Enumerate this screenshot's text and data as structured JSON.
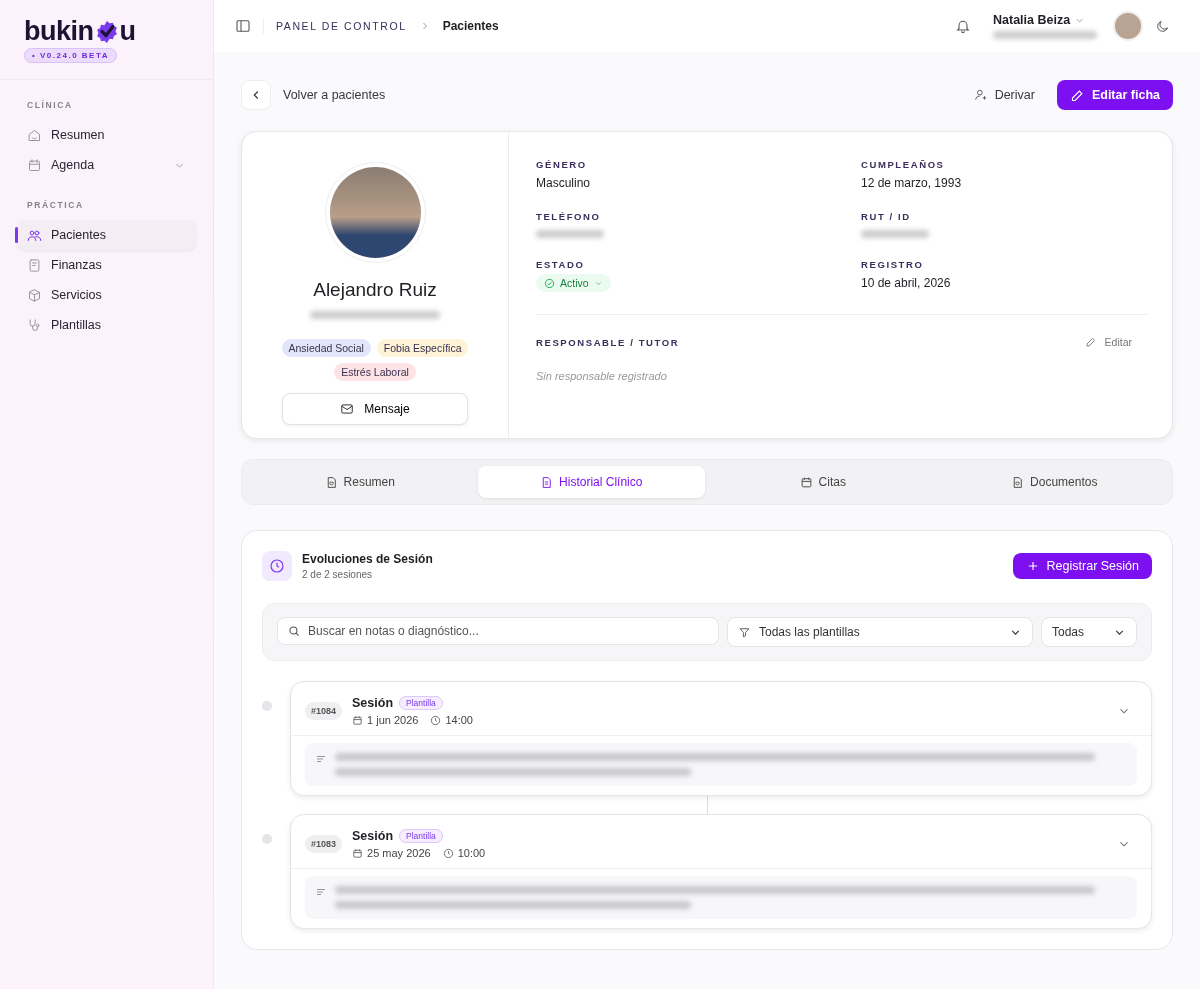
{
  "brand": {
    "text_start": "bukin",
    "text_end": "u",
    "version": "• V0.24.0 BETA"
  },
  "sidebar": {
    "sections": [
      {
        "title": "CLÍNICA",
        "items": [
          {
            "label": "Resumen",
            "selected": false,
            "has_submenu": false
          },
          {
            "label": "Agenda",
            "selected": false,
            "has_submenu": true
          }
        ]
      },
      {
        "title": "PRÁCTICA",
        "items": [
          {
            "label": "Pacientes",
            "selected": true,
            "has_submenu": false
          },
          {
            "label": "Finanzas",
            "selected": false,
            "has_submenu": false
          },
          {
            "label": "Servicios",
            "selected": false,
            "has_submenu": false
          },
          {
            "label": "Plantillas",
            "selected": false,
            "has_submenu": false
          }
        ]
      }
    ]
  },
  "topbar": {
    "breadcrumb": [
      "PANEL DE CONTROL",
      "Pacientes"
    ],
    "user_name": "Natalia Beiza"
  },
  "actions": {
    "back": "Volver a pacientes",
    "refer": "Derivar",
    "edit": "Editar ficha"
  },
  "patient": {
    "name": "Alejandro Ruiz",
    "tags": [
      {
        "label": "Ansiedad Social",
        "color": "#e3e6fb"
      },
      {
        "label": "Fobia Específica",
        "color": "#fdf3d6"
      },
      {
        "label": "Estrés Laboral",
        "color": "#fde2e6"
      }
    ],
    "message_button": "Mensaje",
    "fields": [
      {
        "label": "GÉNERO",
        "value": "Masculino",
        "kind": "text"
      },
      {
        "label": "CUMPLEAÑOS",
        "value": "12 de marzo, 1993",
        "kind": "text"
      },
      {
        "label": "TELÉFONO",
        "kind": "hidden"
      },
      {
        "label": "RUT / ID",
        "kind": "hidden"
      },
      {
        "label": "ESTADO",
        "value": "Activo",
        "kind": "status"
      },
      {
        "label": "REGISTRO",
        "value": "10 de abril, 2026",
        "kind": "text"
      }
    ],
    "guardian": {
      "label": "RESPONSABLE / TUTOR",
      "edit": "Editar",
      "empty": "Sin responsable registrado"
    }
  },
  "tabs": [
    {
      "label": "Resumen",
      "selected": false
    },
    {
      "label": "Historial Clínico",
      "selected": true
    },
    {
      "label": "Citas",
      "selected": false
    },
    {
      "label": "Documentos",
      "selected": false
    }
  ],
  "sessions_panel": {
    "title": "Evoluciones de Sesión",
    "subtitle": "2 de 2 sesiones",
    "add_button": "Registrar Sesión",
    "search": {
      "placeholder": "Buscar en notas o diagnóstico..."
    },
    "template_filter": "Todas las plantillas",
    "status_filter": "Todas",
    "sessions": [
      {
        "number": "#1084",
        "title": "Sesión",
        "badge": "Plantilla",
        "date": "1 jun 2026",
        "time": "14:00"
      },
      {
        "number": "#1083",
        "title": "Sesión",
        "badge": "Plantilla",
        "date": "25 may 2026",
        "time": "10:00"
      }
    ]
  }
}
